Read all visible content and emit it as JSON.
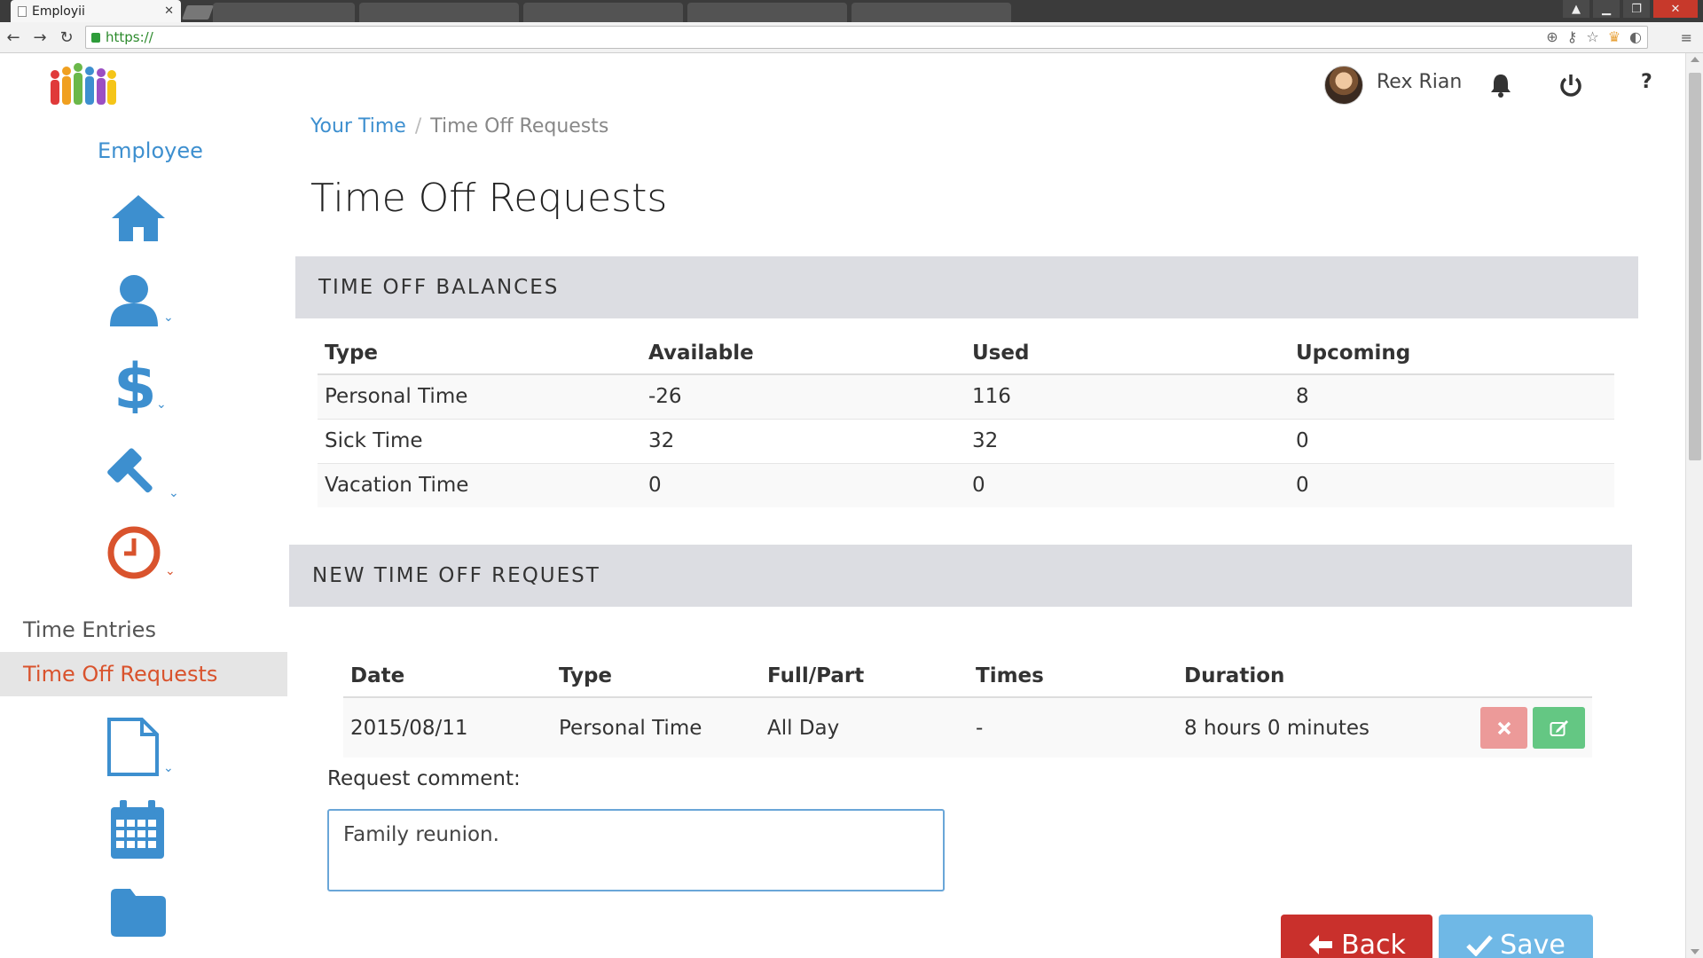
{
  "browser": {
    "tab_title": "Employii",
    "tab_close": "✕",
    "url": "https://"
  },
  "header": {
    "user_name": "Rex Rian",
    "help": "?"
  },
  "sidebar": {
    "role": "Employee",
    "menu": [
      "Time Entries",
      "Time Off Requests"
    ],
    "active_item": "Time Off Requests"
  },
  "breadcrumb": {
    "parent": "Your Time",
    "separator": "/",
    "current": "Time Off Requests"
  },
  "page_title": "Time Off Requests",
  "balances": {
    "heading": "TIME OFF BALANCES",
    "columns": [
      "Type",
      "Available",
      "Used",
      "Upcoming"
    ],
    "rows": [
      [
        "Personal Time",
        "-26",
        "116",
        "8"
      ],
      [
        "Sick Time",
        "32",
        "32",
        "0"
      ],
      [
        "Vacation Time",
        "0",
        "0",
        "0"
      ]
    ]
  },
  "new_request": {
    "heading": "NEW TIME OFF REQUEST",
    "columns": [
      "Date",
      "Type",
      "Full/Part",
      "Times",
      "Duration"
    ],
    "rows": [
      [
        "2015/08/11",
        "Personal Time",
        "All Day",
        "-",
        "8 hours 0 minutes"
      ]
    ],
    "comment_label": "Request comment:",
    "comment_value": "Family reunion."
  },
  "actions": {
    "back_label": "Back",
    "save_label": "Save"
  },
  "colors": {
    "accent_blue": "#3d8fcf",
    "active_orange": "#d9532d",
    "back_red": "#c9302c",
    "save_blue": "#6fb8e6",
    "delete_pink": "#ec9a99",
    "edit_green": "#64c783"
  },
  "icons": [
    "home-icon",
    "user-icon",
    "dollar-icon",
    "gavel-icon",
    "clock-icon",
    "document-icon",
    "calendar-icon",
    "folder-icon",
    "bell-icon",
    "power-icon",
    "help-icon",
    "times-icon",
    "edit-icon",
    "arrow-left-icon",
    "check-icon"
  ]
}
